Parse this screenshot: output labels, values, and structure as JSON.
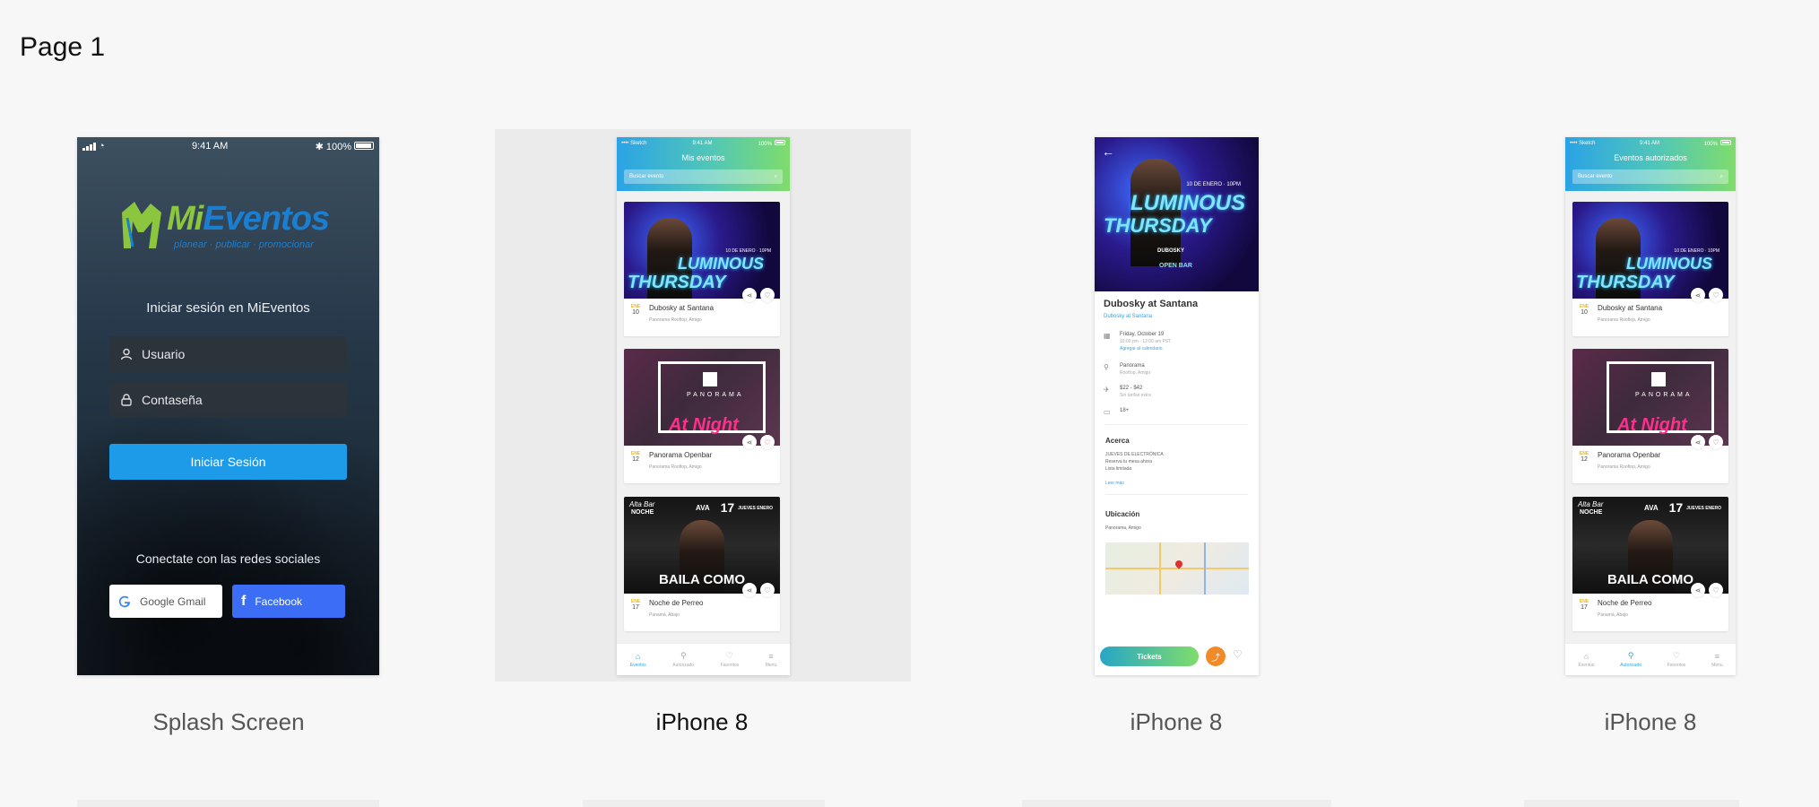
{
  "page": {
    "title": "Page 1"
  },
  "artboards": [
    {
      "label": "Splash Screen"
    },
    {
      "label": "iPhone 8"
    },
    {
      "label": "iPhone 8"
    },
    {
      "label": "iPhone 8"
    }
  ],
  "status": {
    "time": "9:41 AM",
    "battery": "100%"
  },
  "splash": {
    "logo_mi": "Mi",
    "logo_eventos": "Eventos",
    "logo_tagline": "planear · publicar · promocionar",
    "heading": "Iniciar sesión en MiEventos",
    "username_placeholder": "Usuario",
    "password_placeholder": "Contaseña",
    "login_button": "Iniciar Sesión",
    "social_title": "Conectate con las redes sociales",
    "google_button": "Google Gmail",
    "facebook_button": "Facebook"
  },
  "mis_eventos": {
    "title": "Mis eventos",
    "search_placeholder": "Buscar evento",
    "events": [
      {
        "month": "ENE",
        "day": "10",
        "name": "Dubosky at Santana",
        "venue": "Panorama Rooftop, Amigo",
        "poster_headline_1": "LUMINOUS",
        "poster_headline_2": "THURSDAY",
        "poster_date": "10 DE ENERO · 10PM"
      },
      {
        "month": "ENE",
        "day": "12",
        "name": "Panorama Openbar",
        "venue": "Panorama Rooftop, Amigo",
        "poster_word": "PANORAMA",
        "poster_script": "At Night"
      },
      {
        "month": "ENE",
        "day": "17",
        "name": "Noche de Perreo",
        "venue": "Panamá, Abajo",
        "poster_alta": "Alta Bar",
        "poster_noche": "NOCHE",
        "poster_ava": "AVA",
        "poster_date_num": "17",
        "poster_date_word": "JUEVES ENERO",
        "poster_baila": "BAILA COMO"
      }
    ],
    "tabs": [
      {
        "label": "Eventos",
        "icon": "home-icon"
      },
      {
        "label": "Autorizado",
        "icon": "pin-icon"
      },
      {
        "label": "Favoritos",
        "icon": "heart-icon"
      },
      {
        "label": "Menu",
        "icon": "menu-icon"
      }
    ]
  },
  "detail": {
    "title": "Dubosky at Santana",
    "subtitle": "Dubosky at Santana",
    "date_line": "Friday, October 19",
    "time_line": "10:00 pm - 12:00 am PST",
    "add_calendar": "Agregar al calendario",
    "venue_line": "Panorama",
    "venue_sub": "Rooftop, Amigo",
    "price_line": "$22 - $42",
    "price_sub": "Sin tarifas extra",
    "age_line": "18+",
    "about_title": "Acerca",
    "about_lines": [
      "JUEVES DE ELECTRÓNICA",
      "Reserva tu mesa ahora",
      "Lista limitada"
    ],
    "read_more": "Leer más",
    "location_title": "Ubicación",
    "location_sub": "Panorama, Amigo",
    "tickets_button": "Tickets",
    "poster_headline_1": "LUMINOUS",
    "poster_headline_2": "THURSDAY",
    "poster_date": "10 DE ENERO · 10PM",
    "poster_artist": "DUBOSKY",
    "poster_open": "OPEN BAR"
  },
  "autorizados": {
    "title": "Eventos autorizados",
    "search_placeholder": "Buscar evento",
    "events": [
      {
        "month": "ENE",
        "day": "10",
        "name": "Dubosky at Santana",
        "venue": "Panorama Rooftop, Amigo"
      },
      {
        "month": "ENE",
        "day": "12",
        "name": "Panorama Openbar",
        "venue": "Panorama Rooftop, Amigo"
      },
      {
        "month": "ENE",
        "day": "17",
        "name": "Noche de Perreo",
        "venue": "Panamá, Abajo"
      }
    ],
    "tabs": [
      {
        "label": "Eventos"
      },
      {
        "label": "Autorizado"
      },
      {
        "label": "Favoritos"
      },
      {
        "label": "Menu"
      }
    ]
  },
  "colors": {
    "accent": "#2ba7e8",
    "brand_green": "#8cc63f",
    "facebook": "#3b6ef5",
    "heart_red": "#e24a6b"
  }
}
